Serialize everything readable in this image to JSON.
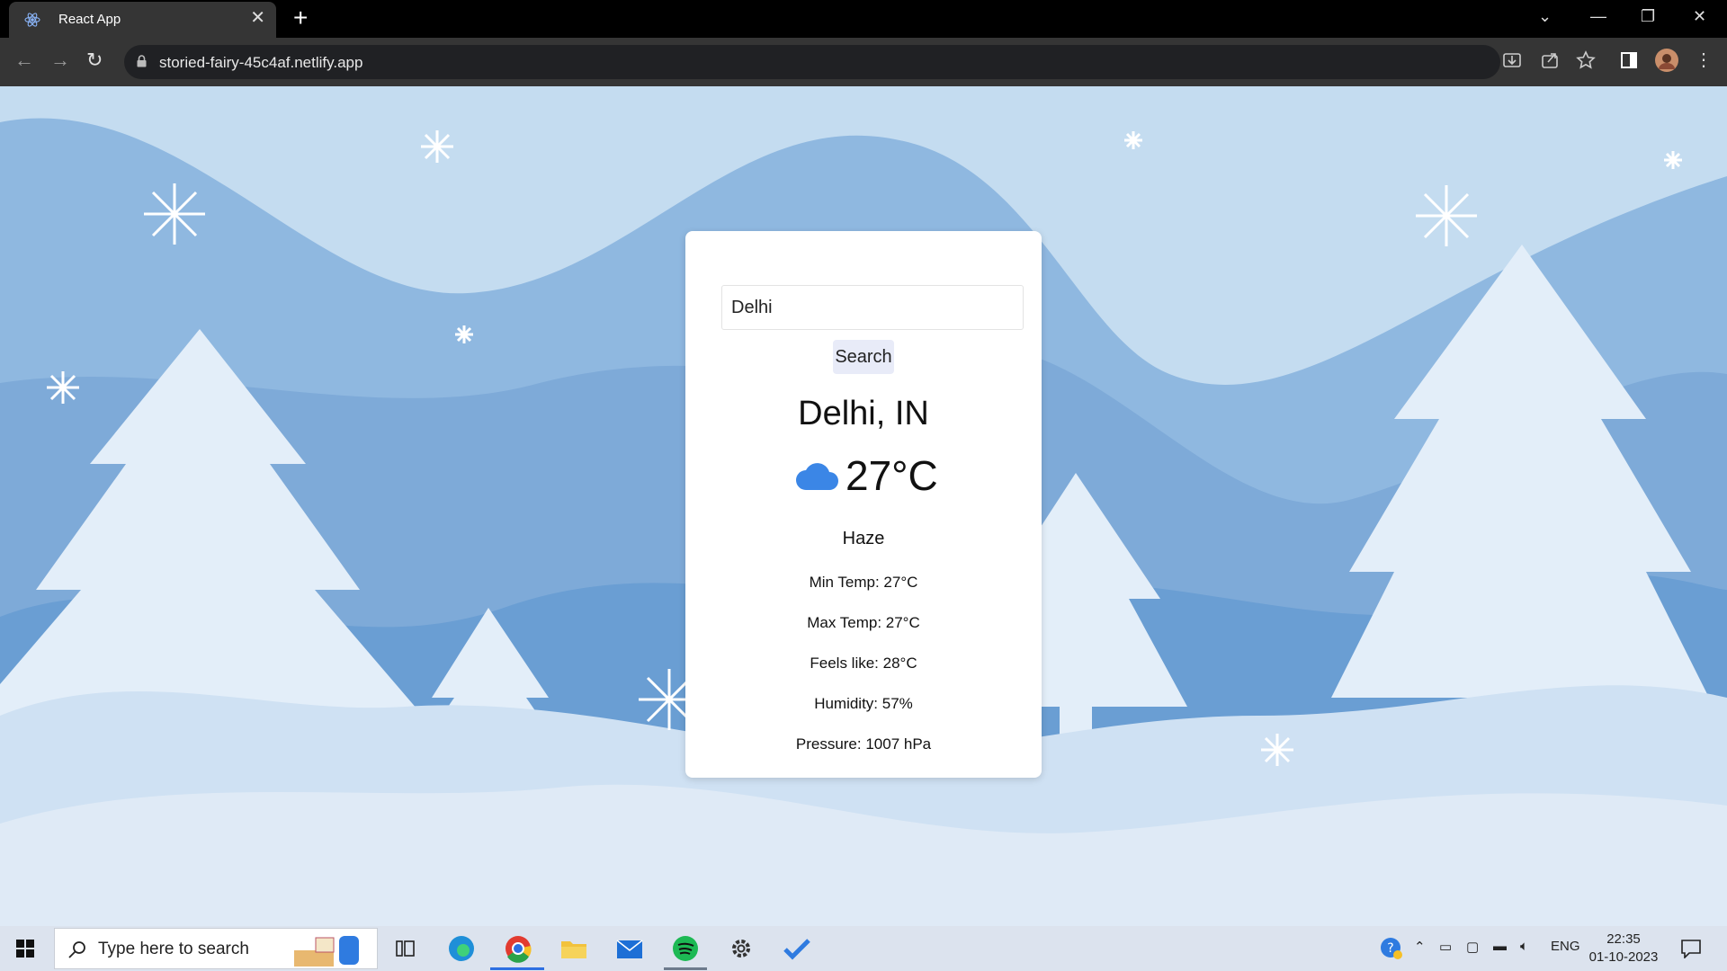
{
  "browser": {
    "tab_title": "React App",
    "url": "storied-fairy-45c4af.netlify.app"
  },
  "search": {
    "input_value": "Delhi",
    "button_label": "Search"
  },
  "weather": {
    "location": "Delhi, IN",
    "icon": "cloud-icon",
    "temperature": "27°C",
    "description": "Haze",
    "min_temp": "Min Temp: 27°C",
    "max_temp": "Max Temp: 27°C",
    "feels_like": "Feels like: 28°C",
    "humidity": "Humidity: 57%",
    "pressure": "Pressure: 1007 hPa"
  },
  "taskbar": {
    "search_placeholder": "Type here to search",
    "language": "ENG",
    "time": "22:35",
    "date": "01-10-2023"
  },
  "colors": {
    "accent_cloud": "#3b86e6",
    "search_button_bg": "#e8ebf8",
    "sky": "#bfd8ef"
  }
}
